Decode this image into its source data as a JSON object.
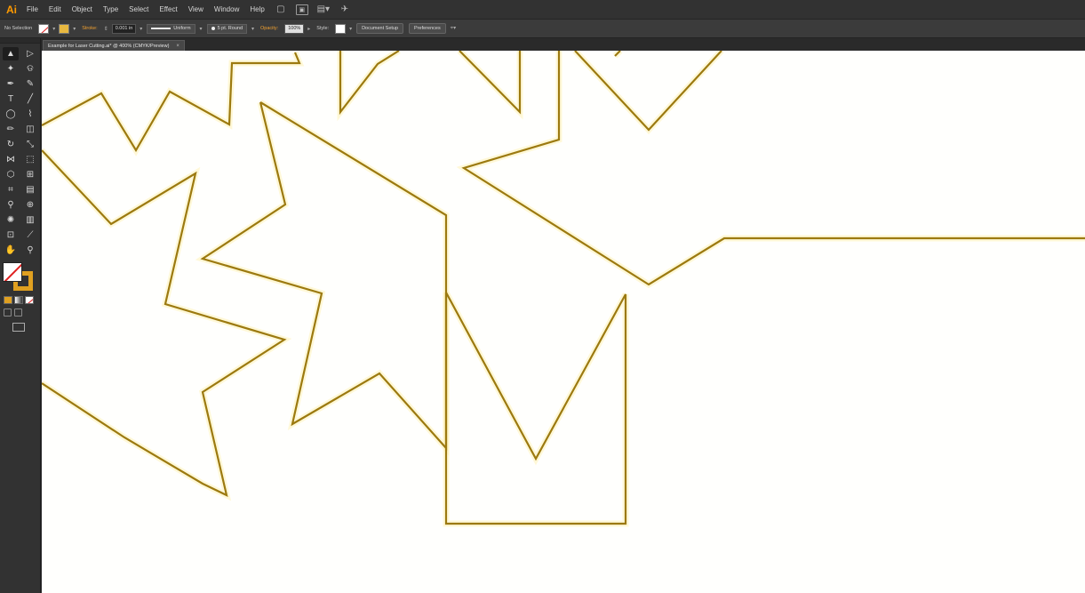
{
  "app": {
    "logo": "Ai"
  },
  "menu": {
    "items": [
      "File",
      "Edit",
      "Object",
      "Type",
      "Select",
      "Effect",
      "View",
      "Window",
      "Help"
    ],
    "icons": [
      "bridge-icon",
      "arrange-documents-icon",
      "workspace-layout-icon",
      "gpu-performance-icon"
    ]
  },
  "control_bar": {
    "selection": "No Selection",
    "stroke_label": "Stroke:",
    "stroke_weight": "0.001 in",
    "profile": "Uniform",
    "brush": "5 pt. Round",
    "opacity_label": "Opacity:",
    "opacity_value": "100%",
    "style_label": "Style:",
    "document_setup": "Document Setup",
    "preferences": "Preferences",
    "colors": {
      "fill": "none",
      "stroke": "#e8b840"
    }
  },
  "document": {
    "tab_title": "Example for Laser Cutting.ai* @ 400% (CMYK/Preview)",
    "close": "×"
  },
  "tools": [
    {
      "name": "selection-tool-icon",
      "glyph": "▲",
      "active": true
    },
    {
      "name": "direct-selection-tool-icon",
      "glyph": "▷"
    },
    {
      "name": "magic-wand-tool-icon",
      "glyph": "✦"
    },
    {
      "name": "lasso-tool-icon",
      "glyph": "ଡ"
    },
    {
      "name": "pen-tool-icon",
      "glyph": "✒"
    },
    {
      "name": "curvature-tool-icon",
      "glyph": "✎"
    },
    {
      "name": "type-tool-icon",
      "glyph": "T"
    },
    {
      "name": "line-segment-tool-icon",
      "glyph": "╱"
    },
    {
      "name": "ellipse-tool-icon",
      "glyph": "◯"
    },
    {
      "name": "paintbrush-tool-icon",
      "glyph": "⌇"
    },
    {
      "name": "pencil-tool-icon",
      "glyph": "✏"
    },
    {
      "name": "eraser-tool-icon",
      "glyph": "◫"
    },
    {
      "name": "rotate-tool-icon",
      "glyph": "↻"
    },
    {
      "name": "scale-tool-icon",
      "glyph": "⤡"
    },
    {
      "name": "width-tool-icon",
      "glyph": "⋈"
    },
    {
      "name": "free-transform-tool-icon",
      "glyph": "⬚"
    },
    {
      "name": "shape-builder-tool-icon",
      "glyph": "⬡"
    },
    {
      "name": "perspective-grid-tool-icon",
      "glyph": "⊞"
    },
    {
      "name": "mesh-tool-icon",
      "glyph": "⌗"
    },
    {
      "name": "gradient-tool-icon",
      "glyph": "▤"
    },
    {
      "name": "eyedropper-tool-icon",
      "glyph": "⚲"
    },
    {
      "name": "blend-tool-icon",
      "glyph": "⊕"
    },
    {
      "name": "symbol-sprayer-tool-icon",
      "glyph": "✺"
    },
    {
      "name": "column-graph-tool-icon",
      "glyph": "▥"
    },
    {
      "name": "artboard-tool-icon",
      "glyph": "⊡"
    },
    {
      "name": "slice-tool-icon",
      "glyph": "⟋"
    },
    {
      "name": "hand-tool-icon",
      "glyph": "✋"
    },
    {
      "name": "zoom-tool-icon",
      "glyph": "⚲"
    }
  ],
  "artwork": {
    "stroke_color": "#9c7a10",
    "paths": [
      "0,84 67,48 106,112 144,46 211,83 214,14 290,14 285,2",
      "0,112 78,195 173,138 139,285 273,325 181,384 208,500 181,487 93,435 0,374",
      "336,0 336,69 378,15 402,0",
      "470,0 538,69 538,0",
      "600,0 683,89 765,0",
      "651,0 645,6",
      "246,58 455,185 455,447 380,363 282,420 315,273 181,234 274,173 246,58",
      "582,0 582,100 475,132 683,263 768,211 1174,211",
      "455,272 556,459 657,274 657,532 455,532 455,272"
    ]
  }
}
